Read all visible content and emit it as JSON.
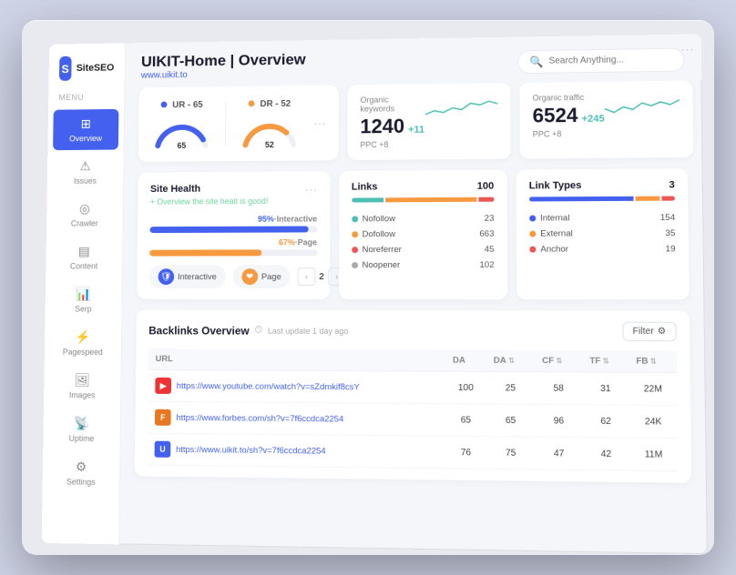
{
  "app": {
    "logo_icon": "S",
    "logo_text": "SiteSEO",
    "menu_label": "Menu"
  },
  "sidebar": {
    "items": [
      {
        "id": "overview",
        "label": "Overview",
        "icon": "⊞",
        "active": true
      },
      {
        "id": "issues",
        "label": "Issues",
        "icon": "⚠",
        "active": false
      },
      {
        "id": "crawler",
        "label": "Crawler",
        "icon": "🕷",
        "active": false
      },
      {
        "id": "content",
        "label": "Content",
        "icon": "📄",
        "active": false
      },
      {
        "id": "serp",
        "label": "Serp",
        "icon": "📊",
        "active": false
      },
      {
        "id": "pagespeed",
        "label": "Pagespeed",
        "icon": "⚡",
        "active": false
      },
      {
        "id": "images",
        "label": "Images",
        "icon": "🖼",
        "active": false
      },
      {
        "id": "uptime",
        "label": "Uptime",
        "icon": "📡",
        "active": false
      },
      {
        "id": "settings",
        "label": "Settings",
        "icon": "⚙",
        "active": false
      }
    ]
  },
  "header": {
    "title": "UIKIT-Home | Overview",
    "subtitle": "www.uikit.to",
    "search_placeholder": "Search Anything..."
  },
  "ur_dr": {
    "ur_label": "UR - 65",
    "dr_label": "DR - 52",
    "ur_color": "#4361ee",
    "dr_color": "#f6993f",
    "ur_value": 65,
    "dr_value": 52
  },
  "organic_keywords": {
    "label": "Organic keywords",
    "value": "1240",
    "delta": "+11",
    "ppc": "PPC +8"
  },
  "organic_traffic": {
    "label": "Organic traffic",
    "value": "6524",
    "delta": "+245",
    "ppc": "PPC +8"
  },
  "site_health": {
    "title": "Site Health",
    "subtitle": "+ Overview the site healt is good!",
    "interactive_pct": 95,
    "interactive_label": "95%",
    "interactive_suffix": "·Interactive",
    "page_pct": 67,
    "page_label": "67%",
    "page_suffix": "·Page",
    "badge1": "Interactive",
    "badge2": "Page",
    "page_current": "2"
  },
  "links": {
    "title": "Links",
    "count": "100",
    "bar_segments": [
      {
        "color": "#4dc0b5",
        "pct": 23
      },
      {
        "color": "#f6993f",
        "pct": 66
      },
      {
        "color": "#f66",
        "pct": 11
      }
    ],
    "rows": [
      {
        "dot": "#4dc0b5",
        "label": "Nofollow",
        "value": "23"
      },
      {
        "dot": "#f6993f",
        "label": "Dofollow",
        "value": "663"
      },
      {
        "dot": "#e55",
        "label": "Noreferrer",
        "value": "45"
      },
      {
        "dot": "#aaa",
        "label": "Noopener",
        "value": "102"
      }
    ]
  },
  "link_types": {
    "title": "Link Types",
    "count": "3",
    "bar_segments": [
      {
        "color": "#4361ee",
        "pct": 74
      },
      {
        "color": "#f6993f",
        "pct": 17
      },
      {
        "color": "#e55",
        "pct": 9
      }
    ],
    "rows": [
      {
        "dot": "#4361ee",
        "label": "Internal",
        "value": "154"
      },
      {
        "dot": "#f6993f",
        "label": "External",
        "value": "35"
      },
      {
        "dot": "#e55",
        "label": "Anchor",
        "value": "19"
      }
    ]
  },
  "backlinks": {
    "title": "Backlinks Overview",
    "timestamp": "Last update 1 day ago",
    "filter_label": "Filter",
    "columns": [
      "URL",
      "DA",
      "DA",
      "CF",
      "TF",
      "FB"
    ],
    "rows": [
      {
        "favicon_bg": "#e33",
        "favicon_text": "▶",
        "url": "https://www.youtube.com/watch?v=sZdmkif8csY",
        "da1": "100",
        "da2": "25",
        "cf": "58",
        "tf": "31",
        "fb": "22M"
      },
      {
        "favicon_bg": "#e87722",
        "favicon_text": "F",
        "url": "https://www.forbes.com/sh?v=7f6ccdca2254",
        "da1": "65",
        "da2": "65",
        "cf": "96",
        "tf": "62",
        "fb": "24K"
      },
      {
        "favicon_bg": "#4361ee",
        "favicon_text": "U",
        "url": "https://www.uikit.to/sh?v=7f6ccdca2254",
        "da1": "76",
        "da2": "75",
        "cf": "47",
        "tf": "42",
        "fb": "11M"
      }
    ]
  }
}
